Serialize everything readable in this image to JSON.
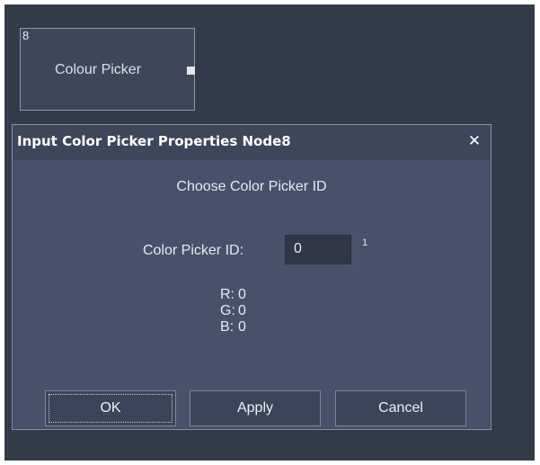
{
  "node": {
    "id": "8",
    "title": "Colour Picker"
  },
  "dialog": {
    "title": "Input Color Picker Properties Node8",
    "close_glyph": "✕",
    "heading": "Choose Color Picker ID",
    "id_label": "Color Picker ID:",
    "id_value": "0",
    "id_max": "1",
    "rgb": [
      {
        "label": "R:",
        "value": "0"
      },
      {
        "label": "G:",
        "value": "0"
      },
      {
        "label": "B:",
        "value": "0"
      }
    ],
    "buttons": {
      "ok": "OK",
      "apply": "Apply",
      "cancel": "Cancel"
    }
  }
}
